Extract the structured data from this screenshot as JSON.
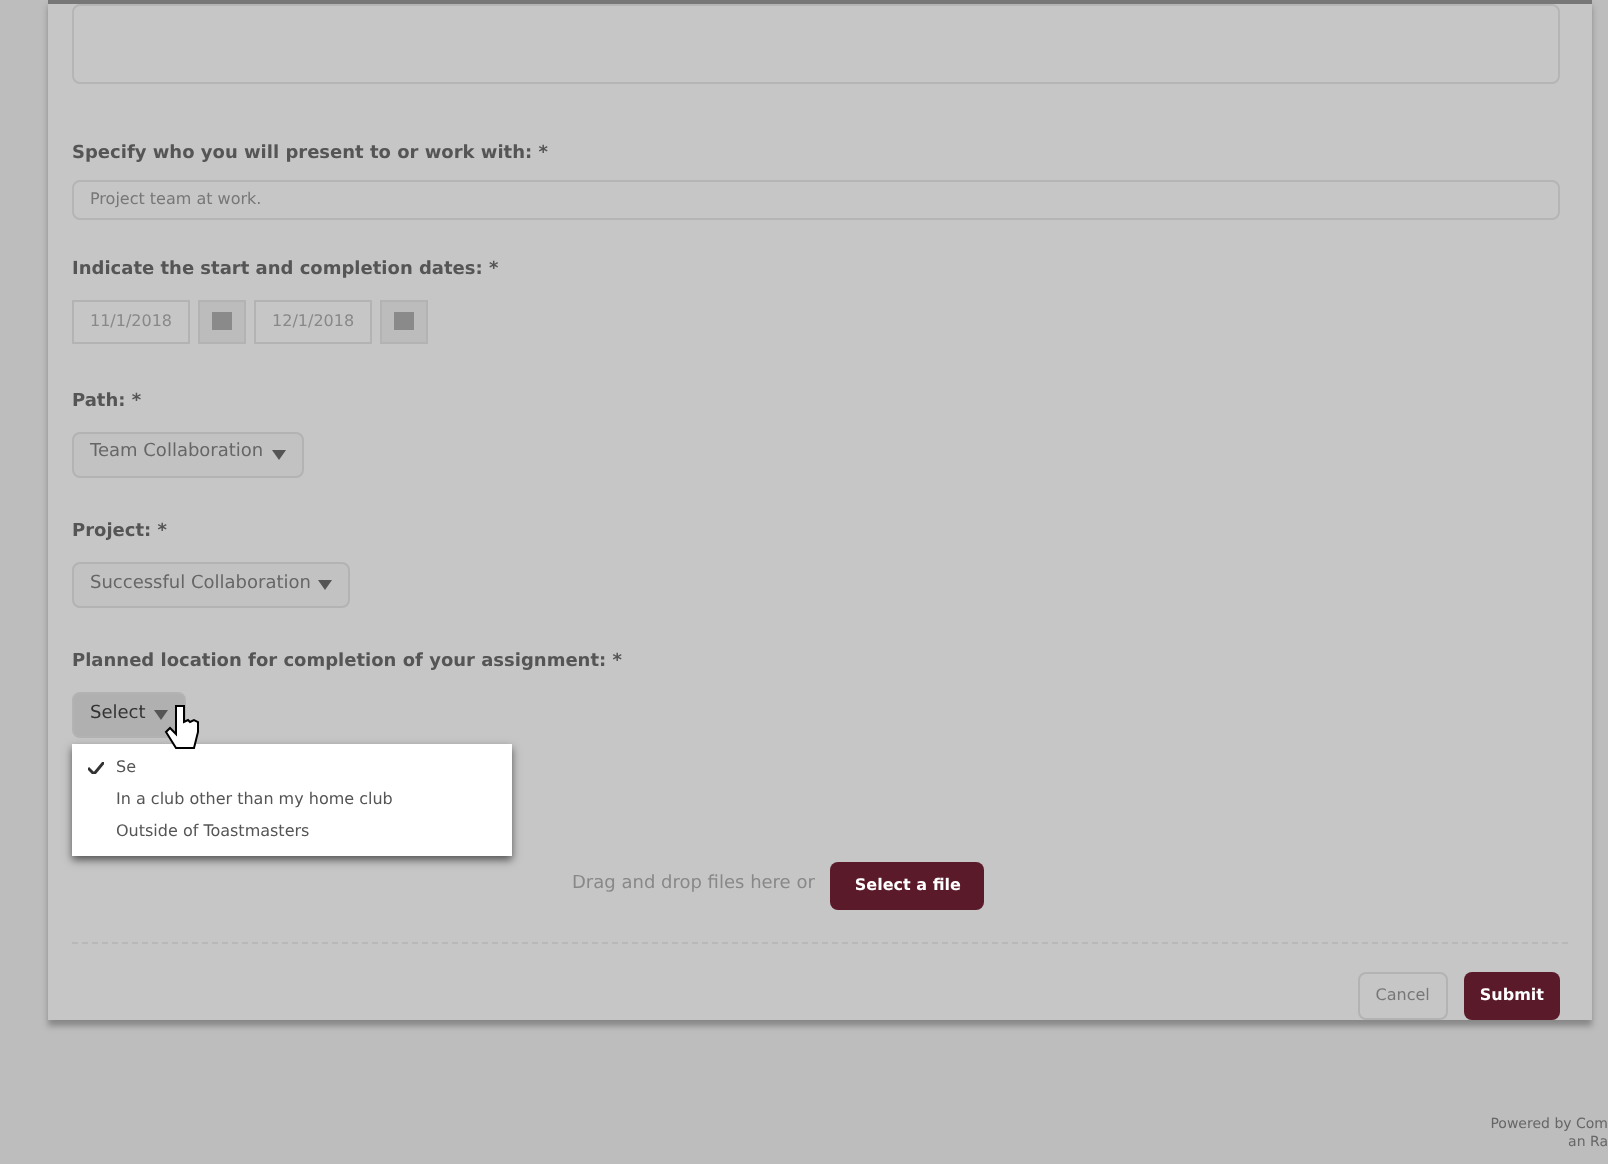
{
  "presenter": {
    "label": "Specify who you will present to or work with: *",
    "value": "Project team at work."
  },
  "dates": {
    "label": "Indicate the start and completion dates: *",
    "start": "11/1/2018",
    "end": "12/1/2018"
  },
  "path": {
    "label": "Path: *",
    "value": "Team Collaboration"
  },
  "project": {
    "label": "Project: *",
    "value": "Successful Collaboration"
  },
  "location": {
    "label": "Planned location for completion of your assignment: *",
    "value": "Select",
    "expanded": true,
    "options": [
      {
        "label": "Se",
        "selected": true
      },
      {
        "label": "In a club other than my home club",
        "selected": false
      },
      {
        "label": "Outside of Toastmasters",
        "selected": false
      }
    ]
  },
  "upload": {
    "text": "Drag and drop files here or",
    "button": "Select a file"
  },
  "buttons": {
    "cancel": "Cancel",
    "submit": "Submit"
  },
  "footer": [
    "Powered by Com",
    "an Ra"
  ]
}
